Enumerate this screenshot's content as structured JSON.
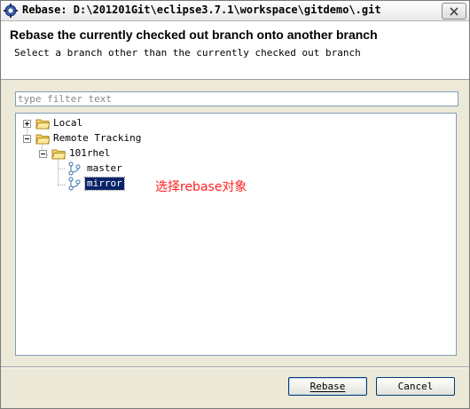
{
  "window": {
    "title": "Rebase: D:\\201201Git\\eclipse3.7.1\\workspace\\gitdemo\\.git"
  },
  "header": {
    "title": "Rebase the currently checked out branch onto another branch",
    "description": "Select a branch other than the currently checked out branch"
  },
  "filter": {
    "placeholder": "type filter text",
    "value": ""
  },
  "tree": {
    "local": "Local",
    "remote_tracking": "Remote Tracking",
    "remote": "101rhel",
    "branch_master": "master",
    "branch_mirror": "mirror"
  },
  "annotation": "选择rebase对象",
  "buttons": {
    "rebase": "Rebase",
    "cancel": "Cancel"
  },
  "colors": {
    "selection": "#0a246a",
    "annotation": "#ff2020",
    "folder": "#f3d46b"
  },
  "icons": {
    "app": "dialog-icon",
    "close": "close-icon",
    "folder": "folder-icon",
    "branch": "branch-icon"
  }
}
